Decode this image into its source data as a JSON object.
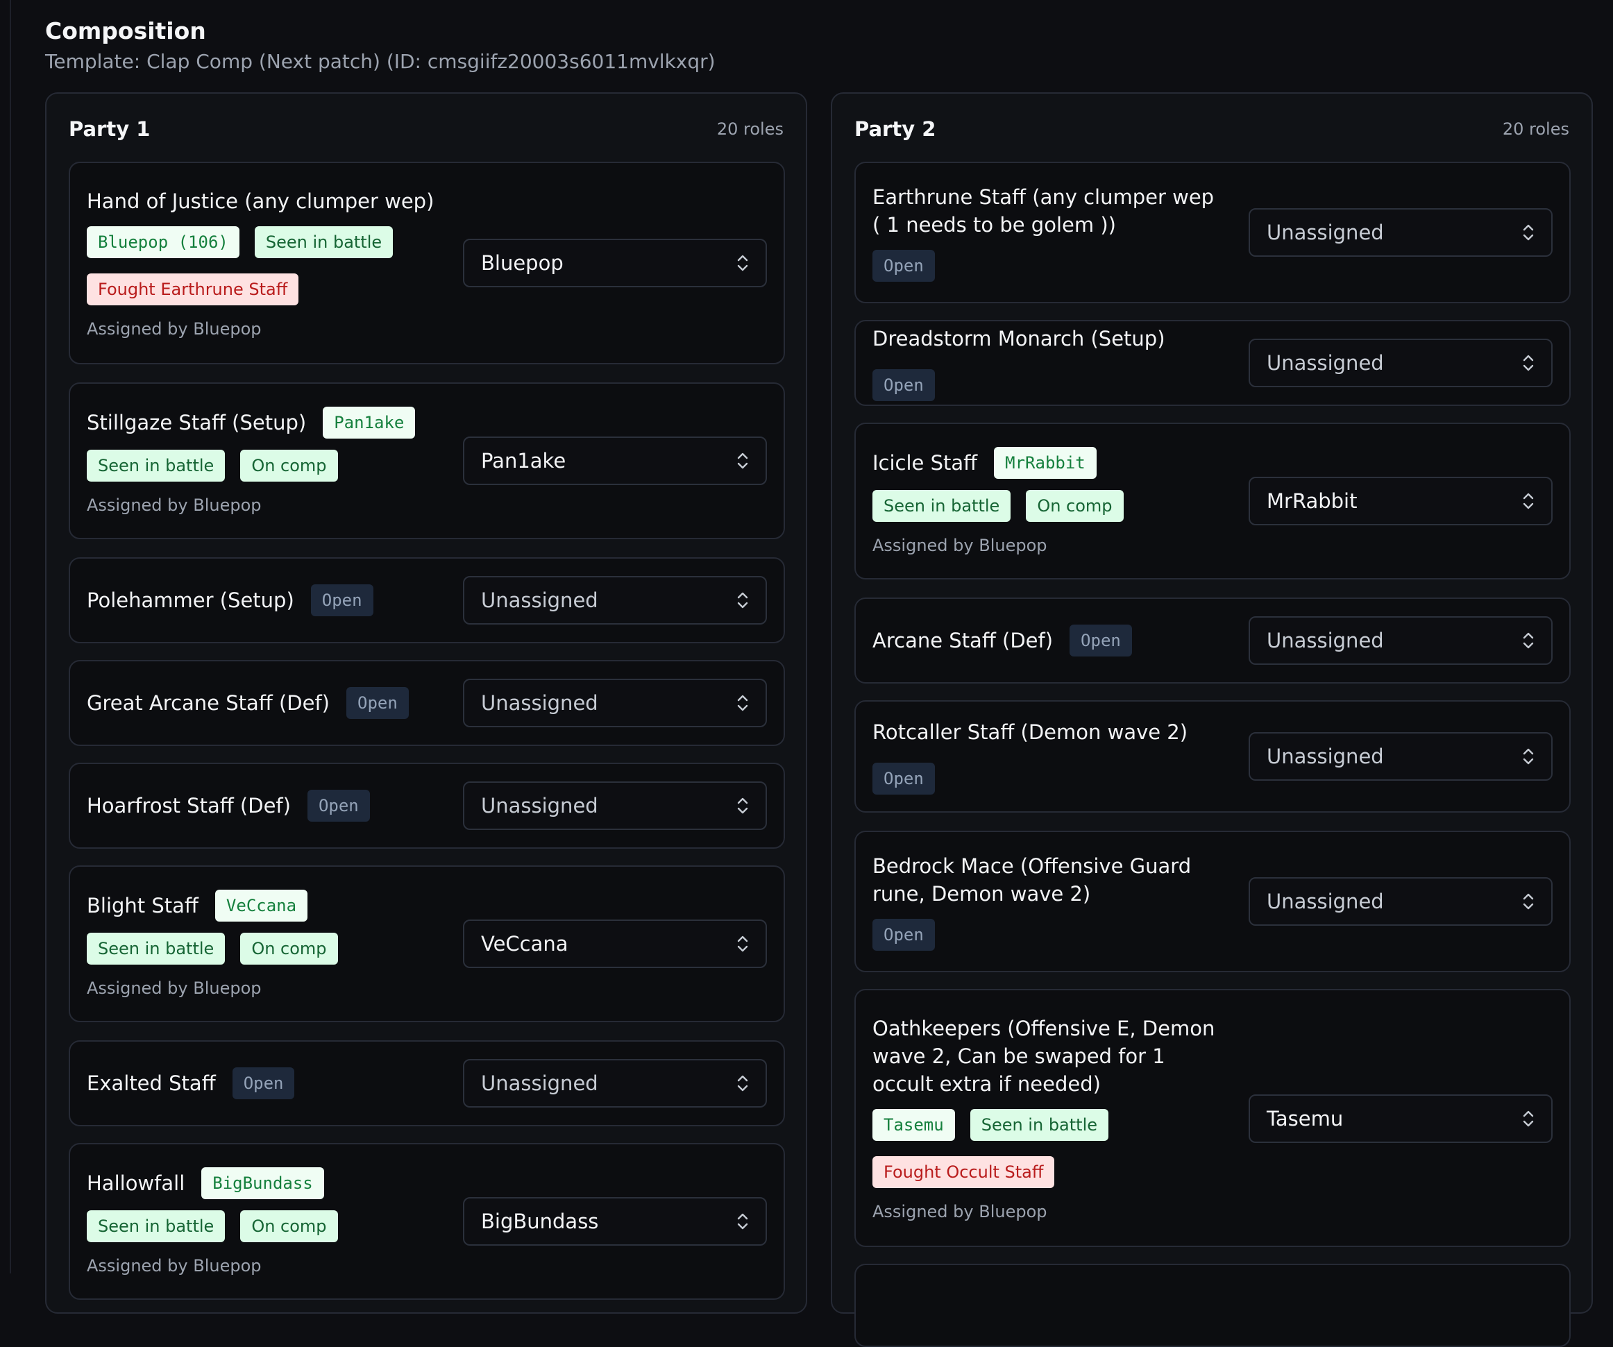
{
  "header": {
    "title": "Composition",
    "subtitle": "Template: Clap Comp (Next patch) (ID: cmsgiifz20003s6011mvlkxqr)"
  },
  "party1": {
    "title": "Party 1",
    "count": "20 roles",
    "roles": [
      {
        "name": "Hand of Justice (any clumper wep)",
        "tag_player": "Bluepop (106)",
        "tag_seen": "Seen in battle",
        "tag_fought": "Fought Earthrune Staff",
        "assigned": "Assigned by Bluepop",
        "select": "Bluepop"
      },
      {
        "name": "Stillgaze Staff (Setup)",
        "tag_player": "Pan1ake",
        "tag_seen": "Seen in battle",
        "tag_comp": "On comp",
        "assigned": "Assigned by Bluepop",
        "select": "Pan1ake"
      },
      {
        "name": "Polehammer (Setup)",
        "tag_open": "Open",
        "select": "Unassigned"
      },
      {
        "name": "Great Arcane Staff (Def)",
        "tag_open": "Open",
        "select": "Unassigned"
      },
      {
        "name": "Hoarfrost Staff (Def)",
        "tag_open": "Open",
        "select": "Unassigned"
      },
      {
        "name": "Blight Staff",
        "tag_player": "VeCcana",
        "tag_seen": "Seen in battle",
        "tag_comp": "On comp",
        "assigned": "Assigned by Bluepop",
        "select": "VeCcana"
      },
      {
        "name": "Exalted Staff",
        "tag_open": "Open",
        "select": "Unassigned"
      },
      {
        "name": "Hallowfall",
        "tag_player": "BigBundass",
        "tag_seen": "Seen in battle",
        "tag_comp": "On comp",
        "assigned": "Assigned by Bluepop",
        "select": "BigBundass"
      }
    ]
  },
  "party2": {
    "title": "Party 2",
    "count": "20 roles",
    "roles": [
      {
        "name": "Earthrune Staff (any clumper wep ( 1 needs to be golem ))",
        "tag_open": "Open",
        "select": "Unassigned"
      },
      {
        "name": "Dreadstorm Monarch (Setup)",
        "tag_open": "Open",
        "select": "Unassigned"
      },
      {
        "name": "Icicle Staff",
        "tag_player": "MrRabbit",
        "tag_seen": "Seen in battle",
        "tag_comp": "On comp",
        "assigned": "Assigned by Bluepop",
        "select": "MrRabbit"
      },
      {
        "name": "Arcane Staff (Def)",
        "tag_open": "Open",
        "select": "Unassigned"
      },
      {
        "name": "Rotcaller Staff (Demon wave 2)",
        "tag_open": "Open",
        "select": "Unassigned"
      },
      {
        "name": "Bedrock Mace (Offensive Guard rune, Demon wave 2)",
        "tag_open": "Open",
        "select": "Unassigned"
      },
      {
        "name": "Oathkeepers (Offensive E, Demon wave 2, Can be swaped for 1 occult extra if needed)",
        "tag_player": "Tasemu",
        "tag_seen": "Seen in battle",
        "tag_fought": "Fought Occult Staff",
        "assigned": "Assigned by Bluepop",
        "select": "Tasemu"
      }
    ]
  }
}
